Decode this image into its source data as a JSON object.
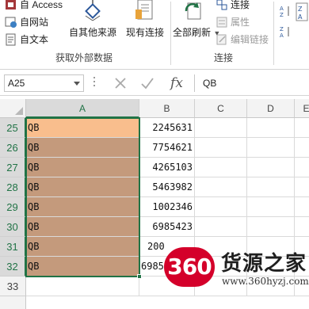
{
  "ribbon": {
    "get_external": {
      "access": "自 Access",
      "web": "自网站",
      "text": "自文本",
      "other_sources": "自其他来源",
      "existing_connections": "现有连接",
      "group_label": "获取外部数据"
    },
    "connections": {
      "refresh_all": "全部刷新",
      "connections": "连接",
      "properties": "属性",
      "edit_links": "编辑链接",
      "group_label": "连接"
    },
    "colors": {
      "accent": "#217346",
      "icon_blue": "#2b579a",
      "disabled_text": "#9a9a9a"
    }
  },
  "formula_bar": {
    "name_box": "A25",
    "fx_label": "fx",
    "content": "QB"
  },
  "grid": {
    "columns": [
      "A",
      "B",
      "C",
      "D",
      "E"
    ],
    "rows": [
      {
        "num": "25",
        "a": "QB",
        "b": "2245631"
      },
      {
        "num": "26",
        "a": "QB",
        "b": "7754621"
      },
      {
        "num": "27",
        "a": "QB",
        "b": "4265103"
      },
      {
        "num": "28",
        "a": "QB",
        "b": "5463982"
      },
      {
        "num": "29",
        "a": "QB",
        "b": "1002346"
      },
      {
        "num": "30",
        "a": "QB",
        "b": "6985423"
      },
      {
        "num": "31",
        "a": "QB",
        "b": "200"
      },
      {
        "num": "32",
        "a": "QB",
        "b": "6985"
      },
      {
        "num": "33",
        "a": "",
        "b": ""
      }
    ],
    "first_cell_fill": "#f9be8d",
    "selected_fill": "#c49a7c"
  },
  "watermark": {
    "badge": "360",
    "title": "货源之家",
    "url": "www.360hyzj.com"
  }
}
